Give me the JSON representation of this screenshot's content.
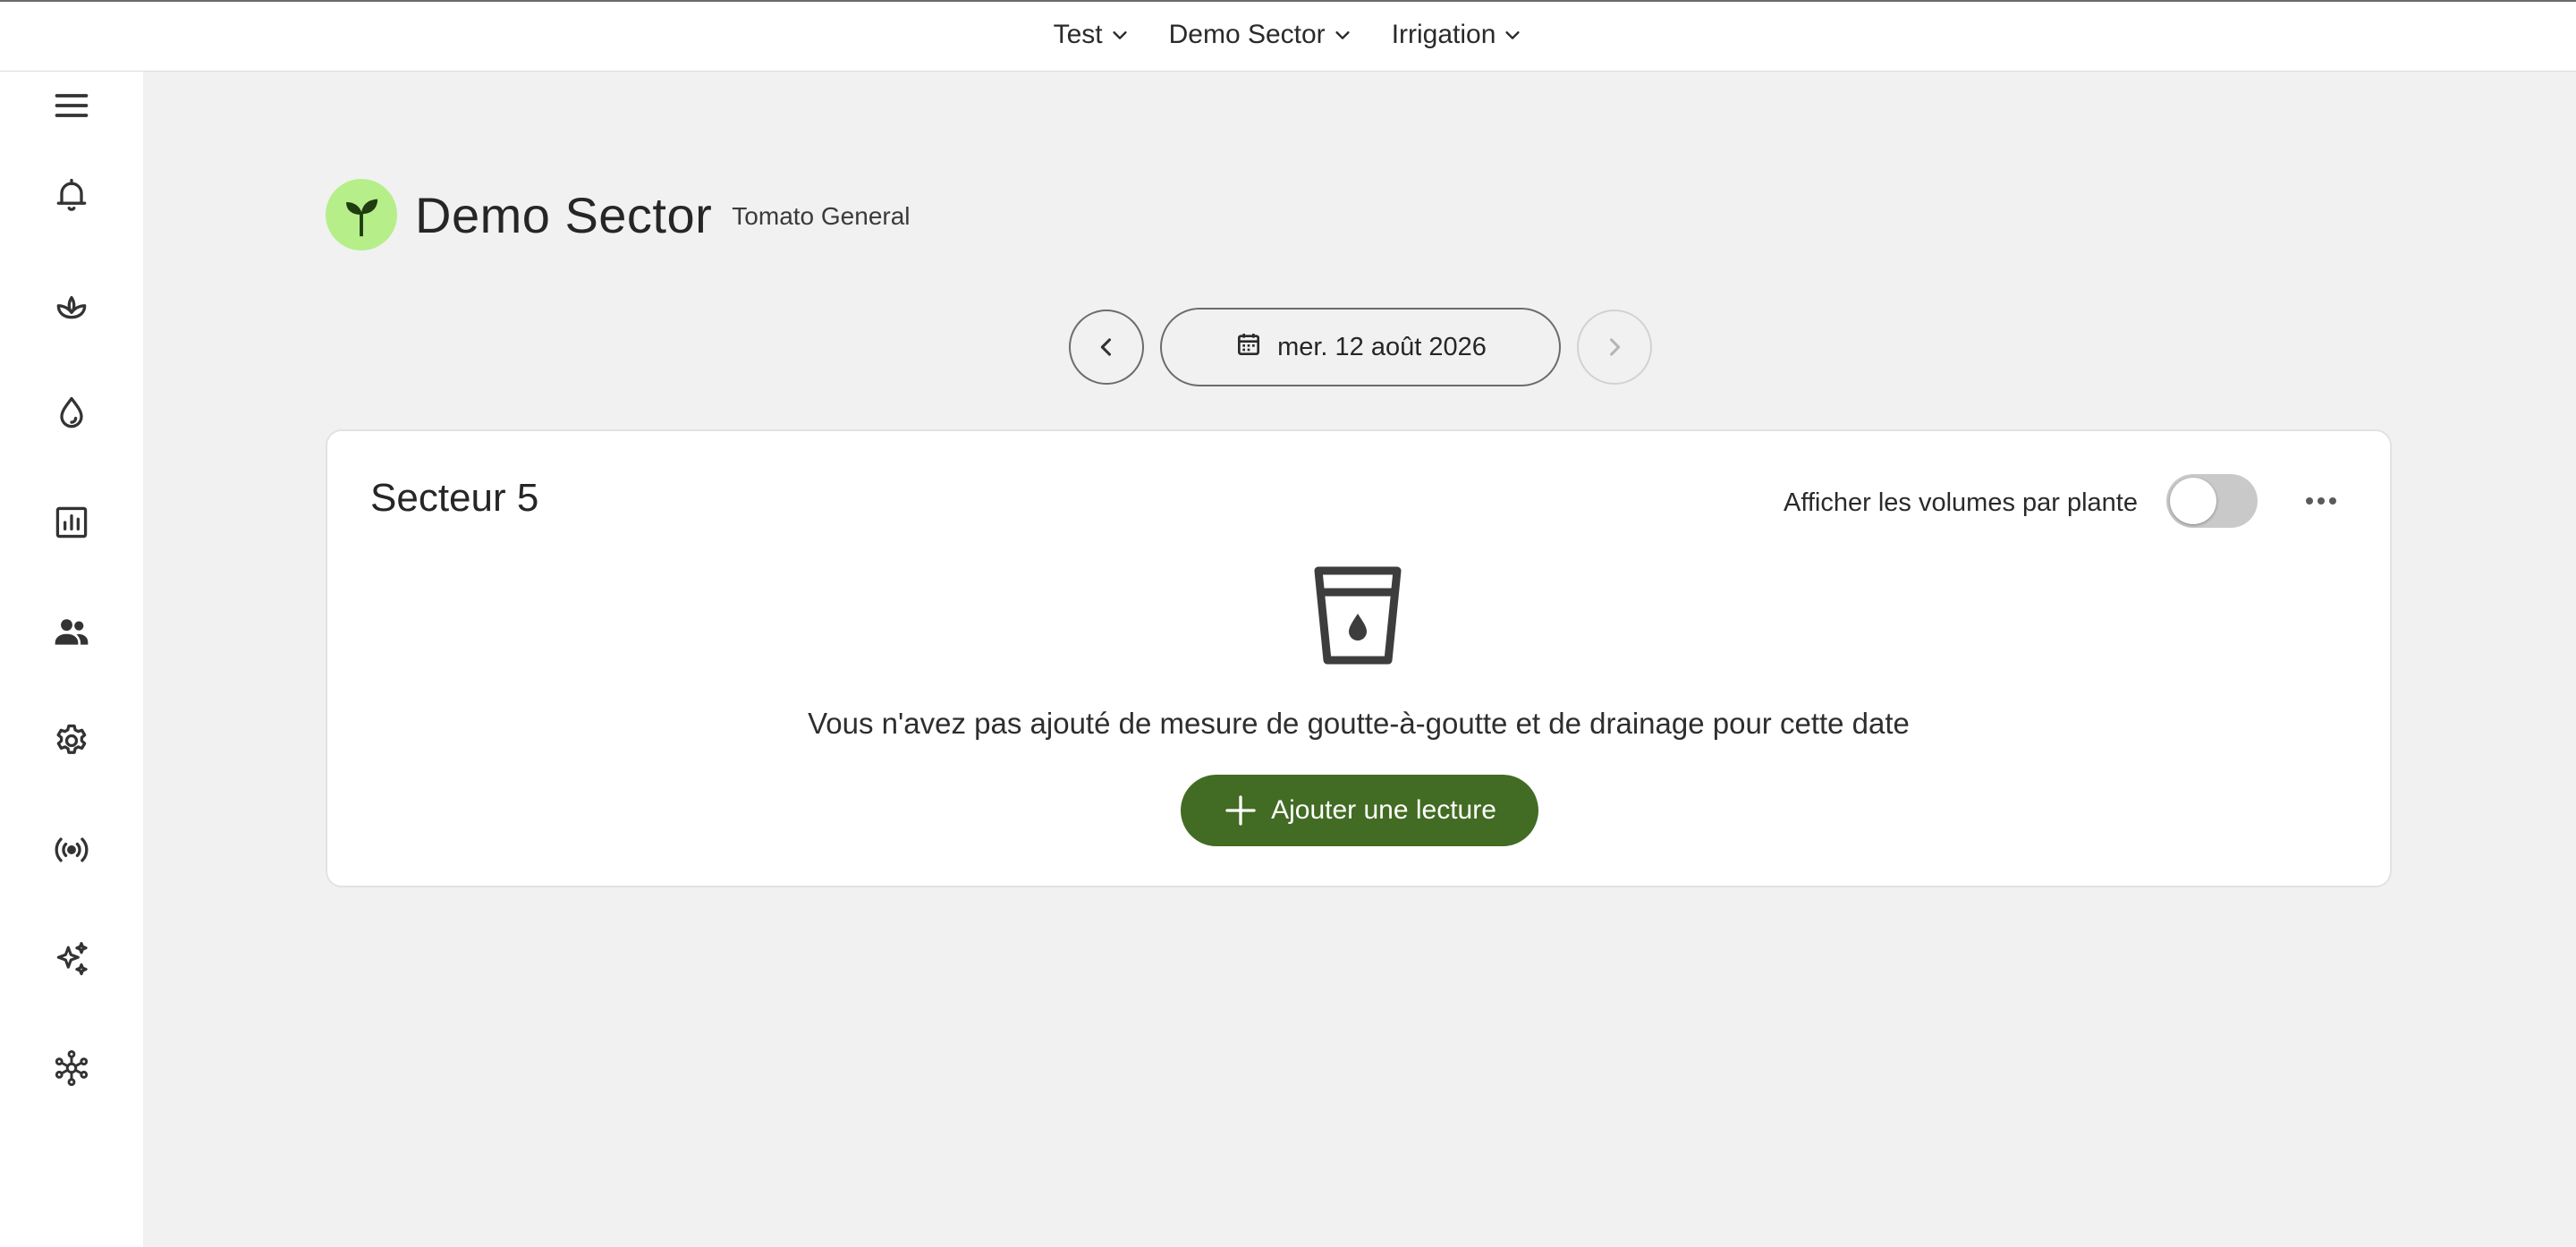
{
  "topbar": {
    "breadcrumbs": [
      {
        "label": "Test",
        "icon": "chevron-down-icon"
      },
      {
        "label": "Demo Sector",
        "icon": "chevron-down-icon"
      },
      {
        "label": "Irrigation",
        "icon": "chevron-down-icon"
      }
    ]
  },
  "sidebar": {
    "items": [
      {
        "icon": "menu-icon"
      },
      {
        "icon": "bell-icon"
      },
      {
        "icon": "sprout-icon"
      },
      {
        "icon": "water-drop-icon"
      },
      {
        "icon": "bar-chart-icon"
      },
      {
        "icon": "users-icon"
      },
      {
        "icon": "gear-icon"
      },
      {
        "icon": "broadcast-icon"
      },
      {
        "icon": "sparkles-icon"
      },
      {
        "icon": "network-icon"
      }
    ]
  },
  "header": {
    "title": "Demo Sector",
    "subtitle": "Tomato General",
    "logo_icon": "leaf-icon",
    "logo_color": "#b6ef8a"
  },
  "datebar": {
    "date": "mer. 12 août 2026",
    "prev_icon": "chevron-left-icon",
    "next_icon": "chevron-right-icon",
    "calendar_icon": "calendar-icon",
    "next_disabled": true
  },
  "card": {
    "title": "Secteur 5",
    "toggle_label": "Afficher les volumes par plante",
    "toggle_on": false,
    "more_icon": "more-horizontal-icon",
    "empty_icon": "water-glass-icon",
    "empty_message": "Vous n'avez pas ajouté de mesure de goutte-à-goutte et de drainage pour cette date",
    "add_button_label": "Ajouter une lecture",
    "add_button_color": "#426b23"
  }
}
